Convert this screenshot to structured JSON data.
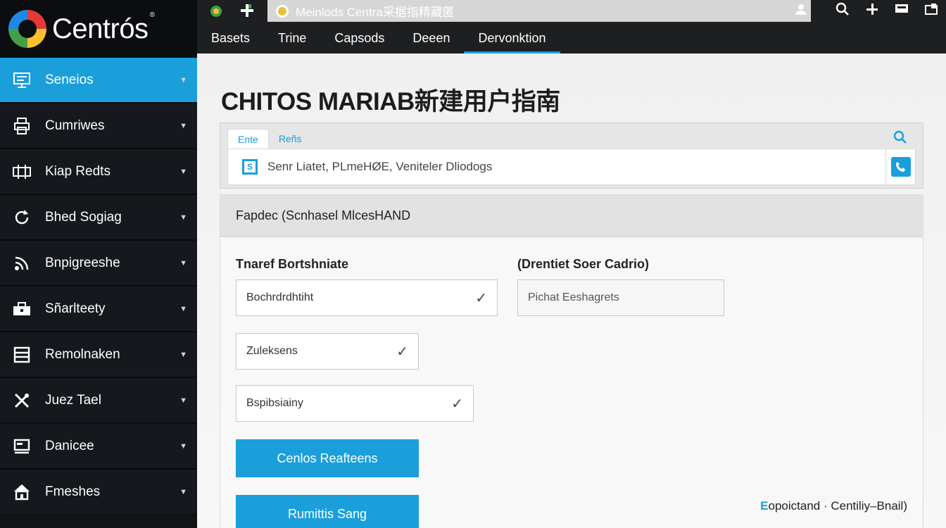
{
  "brand": {
    "name": "Centrós",
    "reg": "®"
  },
  "browser": {
    "url_text": "Meinlods Centra采据指精藏匿",
    "tabs": [
      {
        "label": "Basets"
      },
      {
        "label": "Trine"
      },
      {
        "label": "Capsods"
      },
      {
        "label": "Deeen"
      },
      {
        "label": "Dervonktion"
      }
    ],
    "active_tab": "Dervonktion"
  },
  "sidebar": {
    "items": [
      {
        "label": "Seneios",
        "icon": "dashboard-icon",
        "active": true
      },
      {
        "label": "Cumriwes",
        "icon": "printer-icon"
      },
      {
        "label": "Kiap Redts",
        "icon": "network-icon"
      },
      {
        "label": "Bhed Sogiag",
        "icon": "refresh-icon"
      },
      {
        "label": "Bnpigreeshe",
        "icon": "signal-icon"
      },
      {
        "label": "Sñarlteety",
        "icon": "toolbox-icon"
      },
      {
        "label": "Remolnaken",
        "icon": "panel-icon"
      },
      {
        "label": "Juez Tael",
        "icon": "tools-icon"
      },
      {
        "label": "Danicee",
        "icon": "monitor-icon"
      },
      {
        "label": "Fmeshes",
        "icon": "home-icon"
      }
    ]
  },
  "page": {
    "title": "CHITOS MARIAB新建用户指南"
  },
  "search": {
    "tabs": [
      {
        "label": "Ente"
      },
      {
        "label": "Reñs"
      }
    ],
    "value": "Senr Liatet, PLmeHØE, Veniteler Dliodogs"
  },
  "form": {
    "header": "Fapdec (Scnhasel MlcesHAND",
    "label_left": "Tnaref Bortshniate",
    "label_right": "(Drentiet Soer Cadrio)",
    "select_1": "Bochrdrdhtiht",
    "select_2": "Zuleksens",
    "select_3": "Bspibsiainy",
    "text_field_value": "Pichat Eeshagrets",
    "button_1": "Cenlos Reafteens",
    "button_2": "Rumittis Sang",
    "footer_prefix": "E",
    "footer_text": "opoictand · Centiliy–Bnail)"
  }
}
